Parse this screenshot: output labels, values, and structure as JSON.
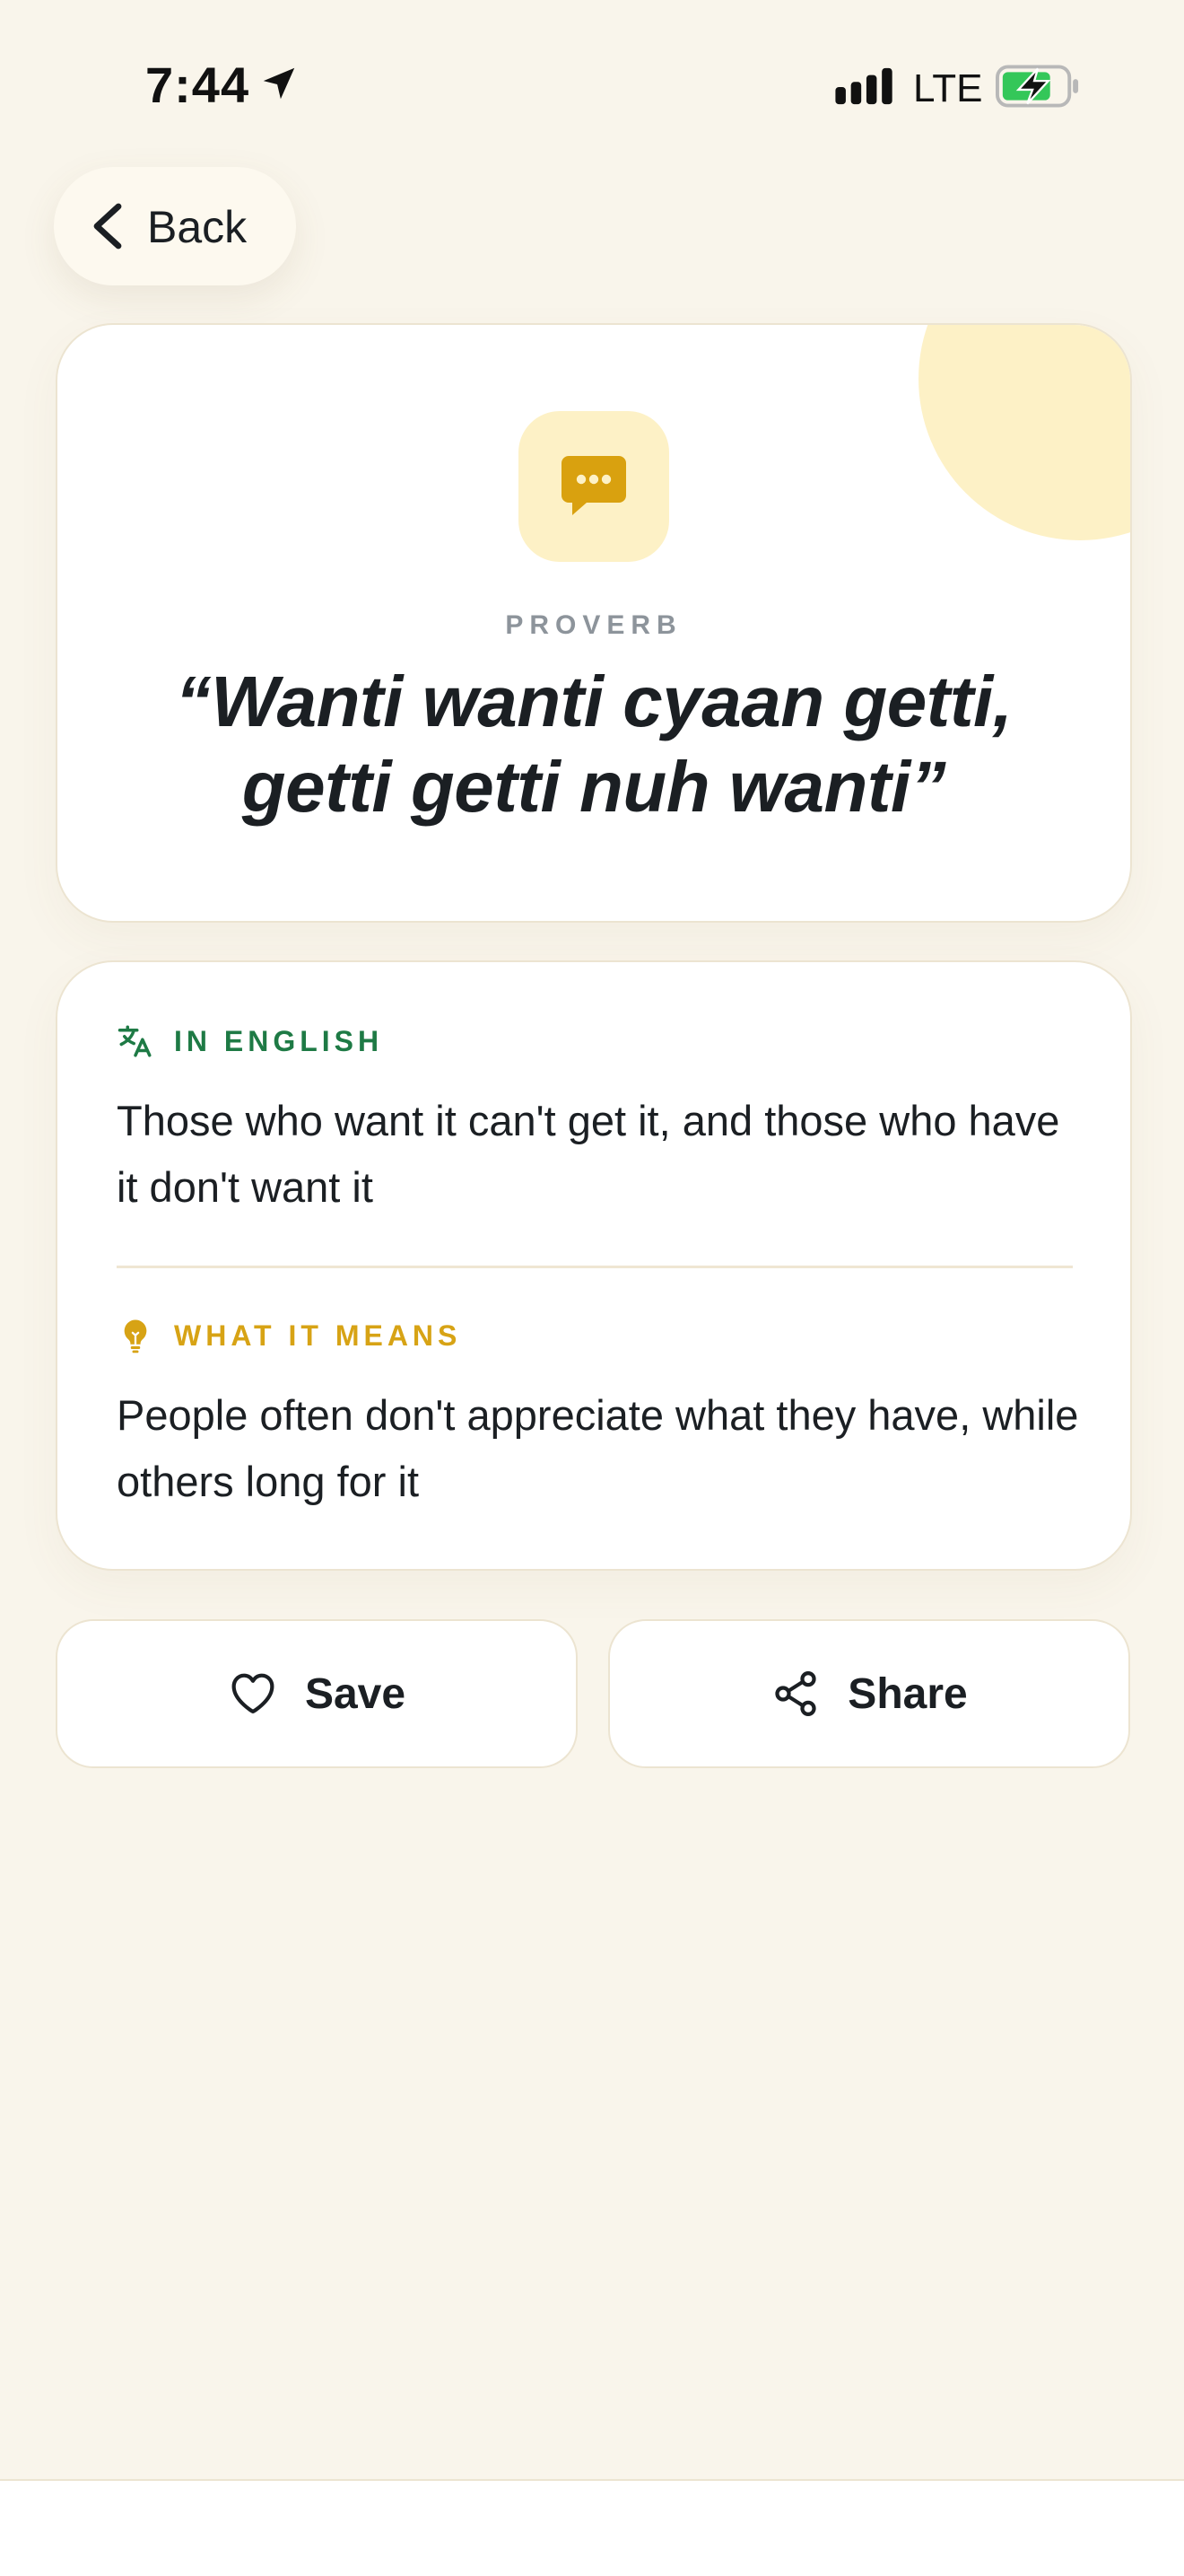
{
  "status_bar": {
    "time": "7:44",
    "network": "LTE",
    "icons": [
      "location-arrow-icon",
      "signal-icon",
      "battery-charging-icon"
    ]
  },
  "nav": {
    "back_label": "Back",
    "icon": "chevron-left-icon"
  },
  "proverb": {
    "icon": "chat-bubble-icon",
    "category": "PROVERB",
    "text": "“Wanti wanti cyaan getti, getti getti nuh wanti”"
  },
  "meaning": {
    "english": {
      "icon": "translate-icon",
      "title": "IN ENGLISH",
      "text": "Those who want it can't get it, and those who have it don't want it"
    },
    "what_it_means": {
      "icon": "lightbulb-icon",
      "title": "WHAT IT MEANS",
      "text": "People often don't appreciate what they have, while others long for it"
    }
  },
  "actions": {
    "save": {
      "label": "Save",
      "icon": "heart-icon"
    },
    "share": {
      "label": "Share",
      "icon": "share-icon"
    }
  },
  "colors": {
    "background": "#f9f5eb",
    "card": "#ffffff",
    "accent_yellow": "#d7a315",
    "accent_yellow_light": "#fdf1c6",
    "accent_green": "#1e7a45",
    "muted_text": "#8d949b",
    "battery_green": "#34c759"
  }
}
